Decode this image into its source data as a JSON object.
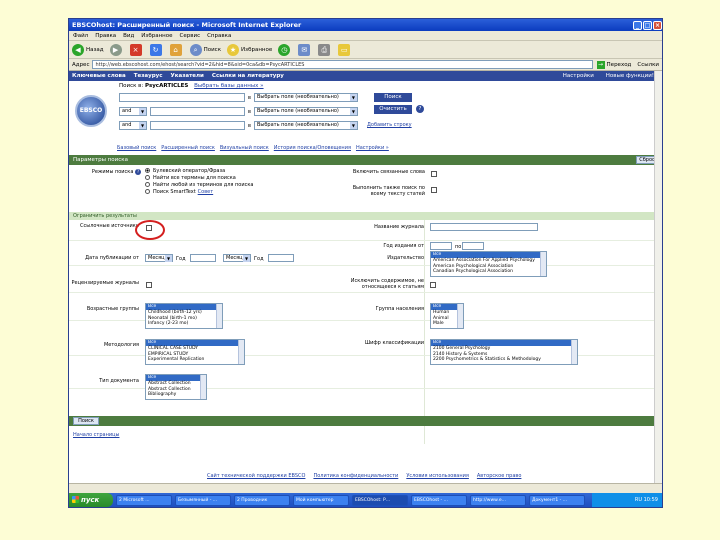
{
  "window": {
    "title": "EBSCOhost: Расширенный поиск - Microsoft Internet Explorer"
  },
  "menu": [
    "Файл",
    "Правка",
    "Вид",
    "Избранное",
    "Сервис",
    "Справка"
  ],
  "toolbar": {
    "back": "Назад",
    "search": "Поиск",
    "favorites": "Избранное"
  },
  "address": {
    "label": "Адрес",
    "url": "http://web.ebscohost.com/ehost/search?vid=2&hid=8&sid=0ca&db=PsycARTICLES",
    "go": "Переход",
    "links": "Ссылки"
  },
  "nav": {
    "items": [
      "Ключевые слова",
      "Тезаурус",
      "Указатели",
      "Ссылки на литературу"
    ],
    "right": [
      "Настройки",
      "Новые функции!"
    ]
  },
  "search": {
    "db_prefix": "Поиск в:",
    "db_name": "PsycARTICLES",
    "db_link": "Выбрать базы данных »",
    "in_label": "в",
    "field_placeholder": "Выбрать поле (необязательно)",
    "bool1": "and",
    "bool2": "and",
    "search_btn": "Поиск",
    "clear_btn": "Очистить",
    "add_row": "Добавить строку",
    "logo": "EBSCO",
    "tabs": [
      "Базовый поиск",
      "Расширенный поиск",
      "Визуальный поиск",
      "История поиска/Оповещения",
      "Настройки »"
    ]
  },
  "options": {
    "header": "Параметры поиска",
    "clear": "Сброс",
    "search_modes_label": "Режимы поиска",
    "modes": [
      "Булевский оператор/Фраза",
      "Найти все термины для поиска",
      "Найти любой из терминов для поиска",
      "Поиск SmartText"
    ],
    "mode_hint": "Совет",
    "related_label": "Включить связанные слова",
    "fulltext_label": "Выполнить также поиск по всему тексту статей"
  },
  "limits": {
    "header": "Ограничить результаты",
    "fulltext_label": "Ссылочные источники",
    "pubdate_label": "Дата публикации от",
    "month_label": "Месяц",
    "year_label": "Год",
    "month2_label": "Месяц",
    "year2_label": "Год",
    "peer_label": "Рецензируемые журналы",
    "pubtype_label": "Возрастные группы",
    "methodology_label": "Методология",
    "doctype_label": "Тип документа",
    "journal_label": "Название журнала",
    "year_pub_label": "Год издания от",
    "year_to": "по",
    "publisher_label": "Издательство",
    "supplement_label": "Исключить содержимое, не относящееся к статьям",
    "population_label": "Группа населения",
    "classification_label": "Шифр классификации",
    "age_groups": [
      "Все",
      "Childhood (birth-12 yrs)",
      "Neonatal (birth-1 mo)",
      "Infancy (2-23 mo)"
    ],
    "methodology": [
      "Все",
      "CLINICAL CASE STUDY",
      "EMPIRICAL STUDY",
      "Experimental Replication"
    ],
    "doc_types": [
      "Все",
      "Abstract Collection",
      "Abstract Collection",
      "Bibliography"
    ],
    "publishers": [
      "Все",
      "American Association For Applied Psychology",
      "American Psychological Association",
      "Canadian Psychological Association"
    ],
    "population": [
      "Все",
      "Human",
      "Animal",
      "Male"
    ],
    "classifications": [
      "Все",
      "2100 General Psychology",
      "2140 History & Systems",
      "2200 Psychometrics & Statistics & Methodology"
    ]
  },
  "footer": {
    "search_btn": "Поиск",
    "top": "Начало страницы",
    "links": [
      "Сайт технической поддержки EBSCO",
      "Политика конфиденциальности",
      "Условия использования",
      "Авторское право"
    ]
  },
  "taskbar": {
    "start": "пуск",
    "tasks": [
      "2 Microsoft ...",
      "Безымянный - ...",
      "2 Проводник",
      "Мой компьютер",
      "EBSCOhost: Р...",
      "EBSCOhost - ...",
      "http://www.e...",
      "Документ1 - ..."
    ],
    "tray": "RU 10:59"
  }
}
